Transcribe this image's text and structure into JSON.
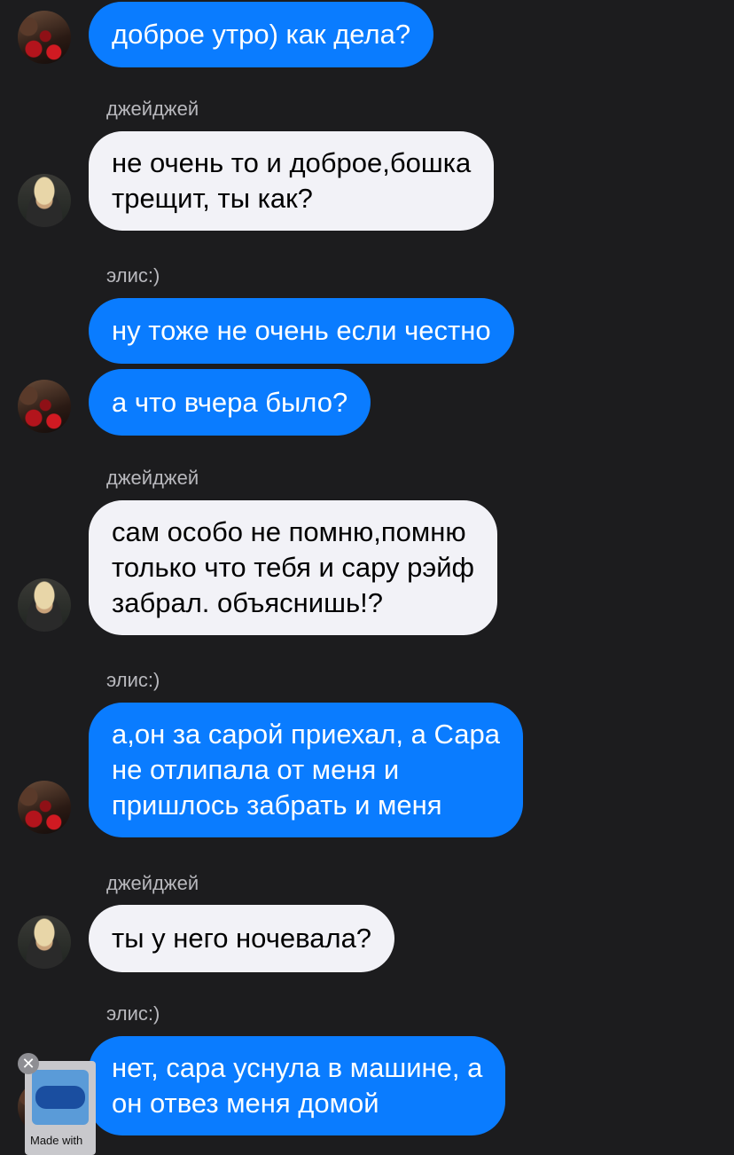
{
  "conversation": {
    "messages": [
      {
        "sender": "элис:)",
        "text": "доброе утро) как дела?",
        "lines": [
          "доброе утро) как дела?"
        ]
      },
      {
        "sender": "джейджей",
        "label": "джейджей",
        "lines": [
          "не очень то и доброе,бошка",
          "трещит, ты как?"
        ]
      },
      {
        "sender": "элис:)",
        "label": "элис:)",
        "lines": [
          "ну тоже не очень если честно"
        ]
      },
      {
        "sender": "элис:)",
        "lines": [
          "а что вчера было?"
        ]
      },
      {
        "sender": "джейджей",
        "label": "джейджей",
        "lines": [
          "сам особо не помню,помню",
          "только  что тебя и сару рэйф",
          "забрал. объяснишь!?"
        ]
      },
      {
        "sender": "элис:)",
        "label": "элис:)",
        "lines": [
          "а,он за сарой приехал, а Сара",
          "не отлипала от меня и",
          "пришлось забрать и меня"
        ]
      },
      {
        "sender": "джейджей",
        "label": "джейджей",
        "lines": [
          "ты у него ночевала?"
        ]
      },
      {
        "sender": "элис:)",
        "label": "элис:)",
        "lines": [
          "нет, сара уснула в машине, а",
          "он отвез меня домой"
        ]
      }
    ]
  },
  "overlay": {
    "watermark": "Made with",
    "close_glyph": "✕"
  },
  "colors": {
    "background": "#1c1c1e",
    "blue_bubble": "#0a7cff",
    "white_bubble": "#f2f2f7",
    "sender_label": "#b8b8bd"
  }
}
